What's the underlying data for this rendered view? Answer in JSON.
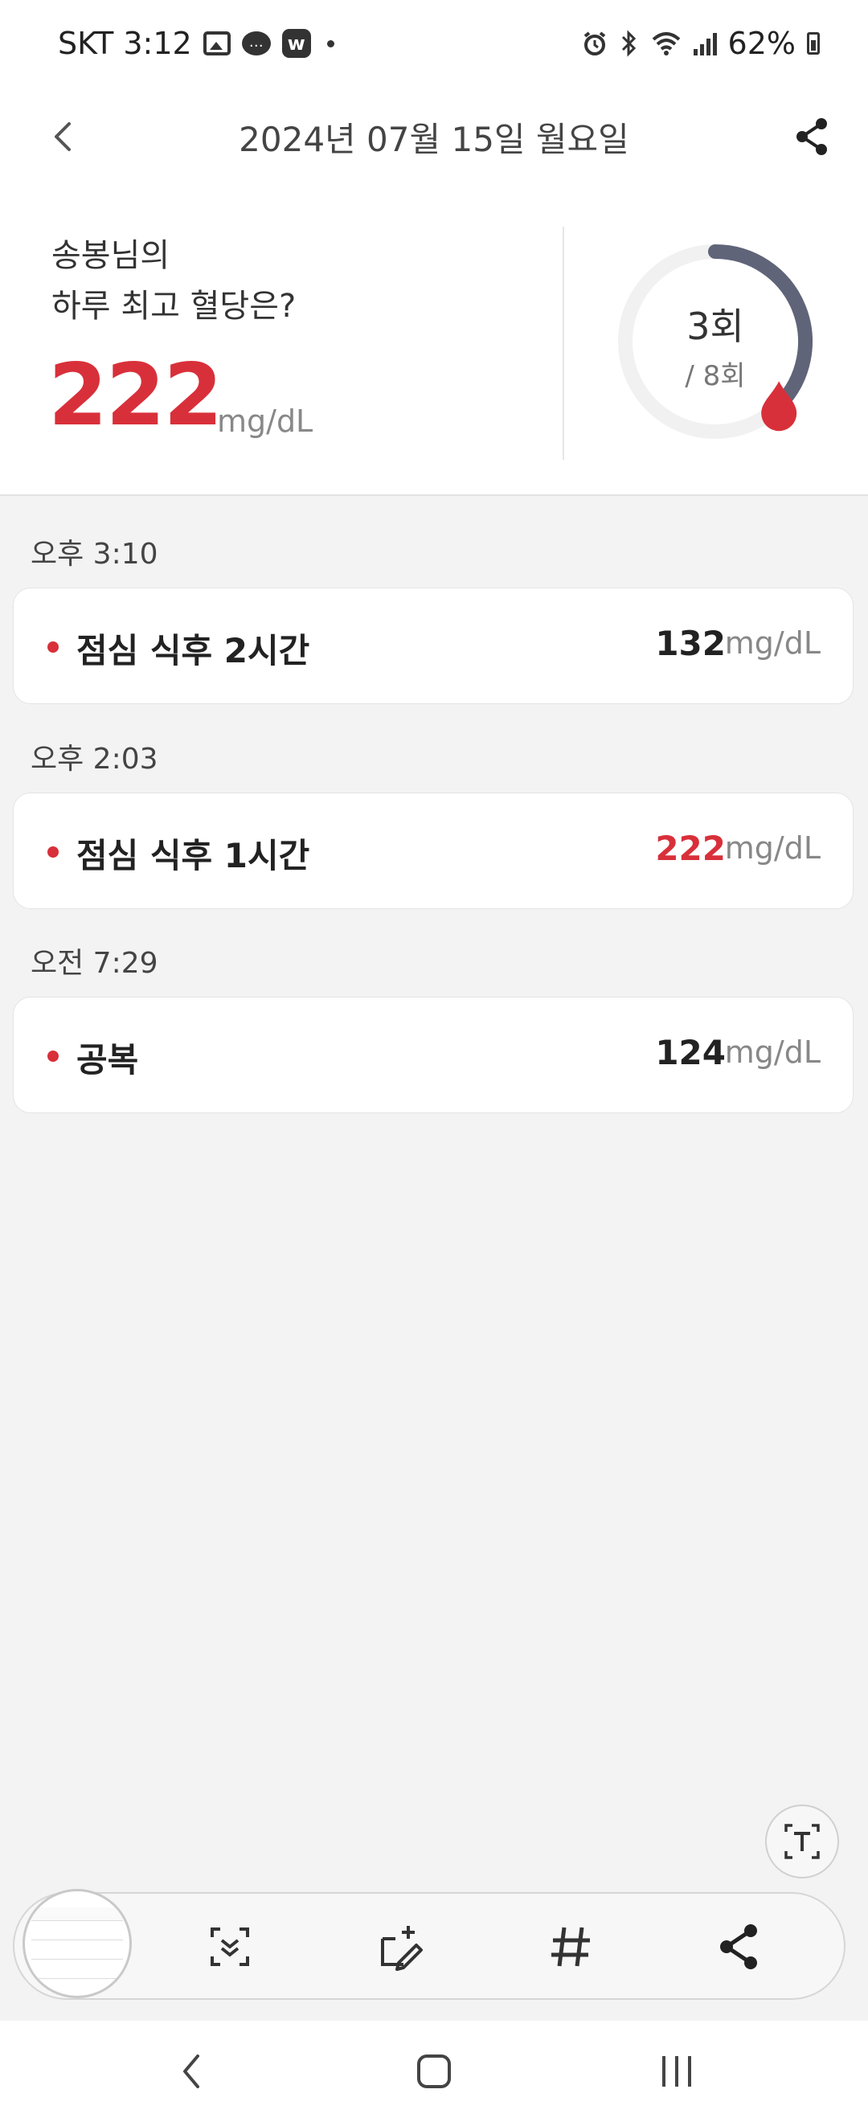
{
  "status_bar": {
    "left_text": "SKT 3:12",
    "battery": "62%",
    "icons": [
      "gallery-icon",
      "chat-icon",
      "w-app-icon",
      "dot-icon",
      "alarm-icon",
      "bluetooth-icon",
      "wifi-icon",
      "signal-icon",
      "battery-icon"
    ]
  },
  "header": {
    "title": "2024년 07월 15일 월요일",
    "back_icon": "chevron-left-icon",
    "share_icon": "share-icon"
  },
  "summary": {
    "line1": "송봉님의",
    "line2": "하루 최고 혈당은?",
    "max_value": "222",
    "unit": "mg/dL",
    "count": "3회",
    "total": "/ 8회",
    "progress_fraction": 0.375,
    "ring_color": "#5f6478",
    "drop_color": "#d8303a"
  },
  "entries": [
    {
      "time": "오후 3:10",
      "label": "점심 식후 2시간",
      "value": "132",
      "unit": "mg/dL",
      "high": false
    },
    {
      "time": "오후 2:03",
      "label": "점심 식후 1시간",
      "value": "222",
      "unit": "mg/dL",
      "high": true
    },
    {
      "time": "오전 7:29",
      "label": "공복",
      "value": "124",
      "unit": "mg/dL",
      "high": false
    }
  ],
  "toolbar": {
    "icons": [
      "screenshot-thumbnail",
      "scroll-capture-icon",
      "edit-crop-icon",
      "hashtag-icon",
      "share-icon"
    ],
    "ocr_icon": "text-extract-icon"
  },
  "nav": {
    "icons": [
      "nav-back-icon",
      "nav-home-icon",
      "nav-recents-icon"
    ]
  },
  "colors": {
    "accent_red": "#d8303a",
    "text_dark": "#222222",
    "background": "#f3f3f3"
  }
}
